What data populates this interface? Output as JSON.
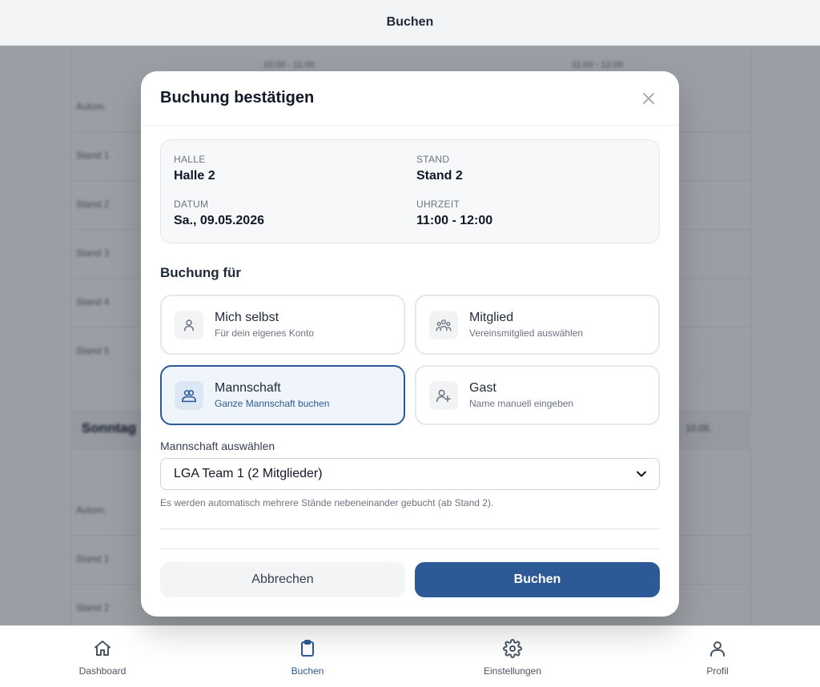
{
  "header": {
    "title": "Buchen"
  },
  "background": {
    "times": [
      "10:00 - 11:00",
      "11:00 - 12:00"
    ],
    "rows_top": [
      "Autom.",
      "Stand 1",
      "Stand 2",
      "Stand 3",
      "Stand 4",
      "Stand 5"
    ],
    "day": "Sonntag",
    "day_right": "10.05.",
    "rows_bottom": [
      "Autom.",
      "Stand 1",
      "Stand 2"
    ]
  },
  "modal": {
    "title": "Buchung bestätigen",
    "info": {
      "hall_label": "HALLE",
      "hall_value": "Halle 2",
      "stand_label": "STAND",
      "stand_value": "Stand 2",
      "date_label": "DATUM",
      "date_value": "Sa., 09.05.2026",
      "time_label": "UHRZEIT",
      "time_value": "11:00 - 12:00"
    },
    "booking_for_title": "Buchung für",
    "options": [
      {
        "title": "Mich selbst",
        "subtitle": "Für dein eigenes Konto",
        "icon": "user-icon",
        "selected": false
      },
      {
        "title": "Mitglied",
        "subtitle": "Vereinsmitglied auswählen",
        "icon": "group-icon",
        "selected": false
      },
      {
        "title": "Mannschaft",
        "subtitle": "Ganze Mannschaft buchen",
        "icon": "team-icon",
        "selected": true
      },
      {
        "title": "Gast",
        "subtitle": "Name manuell eingeben",
        "icon": "user-plus-icon",
        "selected": false
      }
    ],
    "team_select": {
      "label": "Mannschaft auswählen",
      "value": "LGA Team 1 (2 Mitglieder)",
      "hint": "Es werden automatisch mehrere Stände nebeneinander gebucht (ab Stand 2)."
    },
    "cancel_label": "Abbrechen",
    "confirm_label": "Buchen"
  },
  "bottom_nav": {
    "items": [
      {
        "label": "Dashboard",
        "icon": "home-icon",
        "active": false
      },
      {
        "label": "Buchen",
        "icon": "clipboard-icon",
        "active": true
      },
      {
        "label": "Einstellungen",
        "icon": "gear-icon",
        "active": false
      },
      {
        "label": "Profil",
        "icon": "profile-icon",
        "active": false
      }
    ]
  },
  "colors": {
    "accent": "#2d5a96",
    "overlay": "#111827"
  }
}
